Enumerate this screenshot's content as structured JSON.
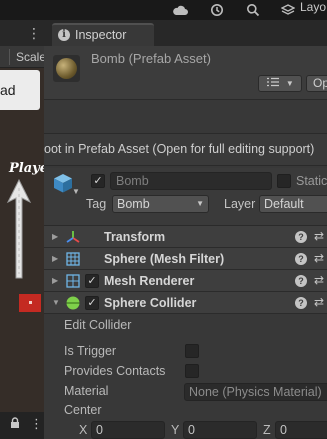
{
  "topbar": {
    "layers_label": "Layo",
    "icons": [
      "cloud-icon",
      "history-icon",
      "search-icon"
    ]
  },
  "scene": {
    "toolbar_scale": "Scale",
    "popup_text": "ad",
    "player_label": "Player"
  },
  "inspector": {
    "tab_label": "Inspector",
    "asset_title": "Bomb (Prefab Asset)",
    "open_button": "Op",
    "notice": "Root in Prefab Asset (Open for full editing support)",
    "gameobject": {
      "active": true,
      "name": "Bomb",
      "static_label": "Static",
      "tag_label": "Tag",
      "tag_value": "Bomb",
      "layer_label": "Layer",
      "layer_value": "Default"
    },
    "components": [
      {
        "title": "Transform",
        "expanded": false,
        "has_toggle": false
      },
      {
        "title": "Sphere (Mesh Filter)",
        "expanded": false,
        "has_toggle": false
      },
      {
        "title": "Mesh Renderer",
        "expanded": false,
        "has_toggle": true
      },
      {
        "title": "Sphere Collider",
        "expanded": true,
        "has_toggle": true
      }
    ],
    "collider": {
      "edit_collider": "Edit Collider",
      "is_trigger_label": "Is Trigger",
      "is_trigger": false,
      "provides_contacts_label": "Provides Contacts",
      "provides_contacts": false,
      "material_label": "Material",
      "material_value": "None (Physics Material)",
      "center_label": "Center",
      "center": {
        "x_label": "X",
        "x": "0",
        "y_label": "Y",
        "y": "0",
        "z_label": "Z",
        "z": "0"
      }
    }
  }
}
